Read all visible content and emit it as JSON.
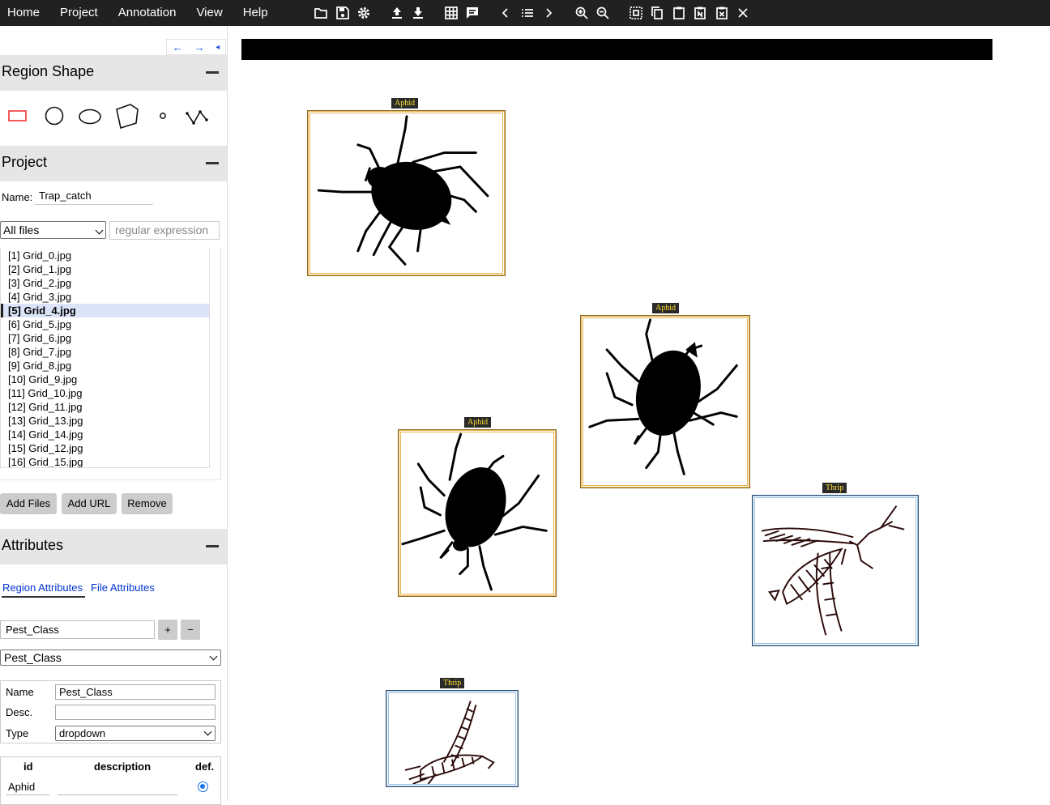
{
  "menu": {
    "items": [
      "Home",
      "Project",
      "Annotation",
      "View",
      "Help"
    ]
  },
  "toolbar_icons": [
    "folder-open-icon",
    "save-icon",
    "settings-icon",
    "upload-icon",
    "download-icon",
    "grid-view-icon",
    "comment-icon",
    "prev-icon",
    "list-icon",
    "next-icon",
    "zoom-in-icon",
    "zoom-out-icon",
    "select-all-icon",
    "copy-icon",
    "paste-icon",
    "paste-n-icon",
    "paste-delete-icon",
    "close-icon"
  ],
  "nav_arrows": {
    "left": "←",
    "right": "→",
    "collapse": "◂"
  },
  "region_shape": {
    "title": "Region Shape",
    "shapes": [
      "rectangle",
      "circle",
      "ellipse",
      "polygon",
      "point",
      "polyline"
    ]
  },
  "project": {
    "title": "Project",
    "name_label": "Name:",
    "name_value": "Trap_catch",
    "filter_selected": "All files",
    "regex_placeholder": "regular expression",
    "files": [
      "[1] Grid_0.jpg",
      "[2] Grid_1.jpg",
      "[3] Grid_2.jpg",
      "[4] Grid_3.jpg",
      "[5] Grid_4.jpg",
      "[6] Grid_5.jpg",
      "[7] Grid_6.jpg",
      "[8] Grid_7.jpg",
      "[9] Grid_8.jpg",
      "[10] Grid_9.jpg",
      "[11] Grid_10.jpg",
      "[12] Grid_11.jpg",
      "[13] Grid_13.jpg",
      "[14] Grid_14.jpg",
      "[15] Grid_12.jpg",
      "[16] Grid_15.jpg"
    ],
    "active_file_index": 4,
    "buttons": {
      "add_files": "Add Files",
      "add_url": "Add URL",
      "remove": "Remove"
    }
  },
  "attributes": {
    "title": "Attributes",
    "tabs": {
      "region": "Region Attributes",
      "file": "File Attributes"
    },
    "new_attr_value": "Pest_Class",
    "plus": "+",
    "minus": "−",
    "selected_attr": "Pest_Class",
    "details": {
      "name_label": "Name",
      "name_value": "Pest_Class",
      "desc_label": "Desc.",
      "desc_value": "",
      "type_label": "Type",
      "type_value": "dropdown"
    },
    "options_table": {
      "headers": [
        "id",
        "description",
        "def."
      ],
      "rows": [
        {
          "id": "Aphid",
          "description": "",
          "default": true
        }
      ]
    }
  },
  "regions": [
    {
      "label": "Aphid",
      "class": "aphid"
    },
    {
      "label": "Aphid",
      "class": "aphid"
    },
    {
      "label": "Aphid",
      "class": "aphid"
    },
    {
      "label": "Thrip",
      "class": "thrip"
    },
    {
      "label": "Thrip",
      "class": "thrip"
    }
  ],
  "colors": {
    "topbar": "#212121",
    "aphid_border": "#e6b24c",
    "thrip_border": "#9fc2e0",
    "label_text": "#ffe033",
    "active_file": "#dbe3f8"
  }
}
